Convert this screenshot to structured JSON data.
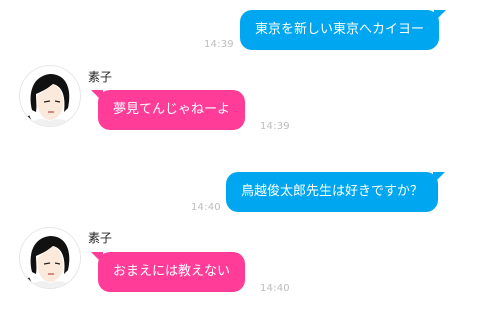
{
  "messages": [
    {
      "direction": "outgoing",
      "text": "東京を新しい東京へカイヨー",
      "time": "14:39"
    },
    {
      "direction": "incoming",
      "sender": "素子",
      "text": "夢見てんじゃねーよ",
      "time": "14:39"
    },
    {
      "direction": "outgoing",
      "text": "鳥越俊太郎先生は好きですか？",
      "time": "14:40"
    },
    {
      "direction": "incoming",
      "sender": "素子",
      "text": "おまえには教えない",
      "time": "14:40"
    }
  ],
  "colors": {
    "outgoing_bubble": "#00a7f0",
    "incoming_bubble": "#ff3d98",
    "timestamp": "#bdbdbd",
    "background": "#ffffff"
  },
  "icons": {
    "avatar": "avatar-icon"
  }
}
